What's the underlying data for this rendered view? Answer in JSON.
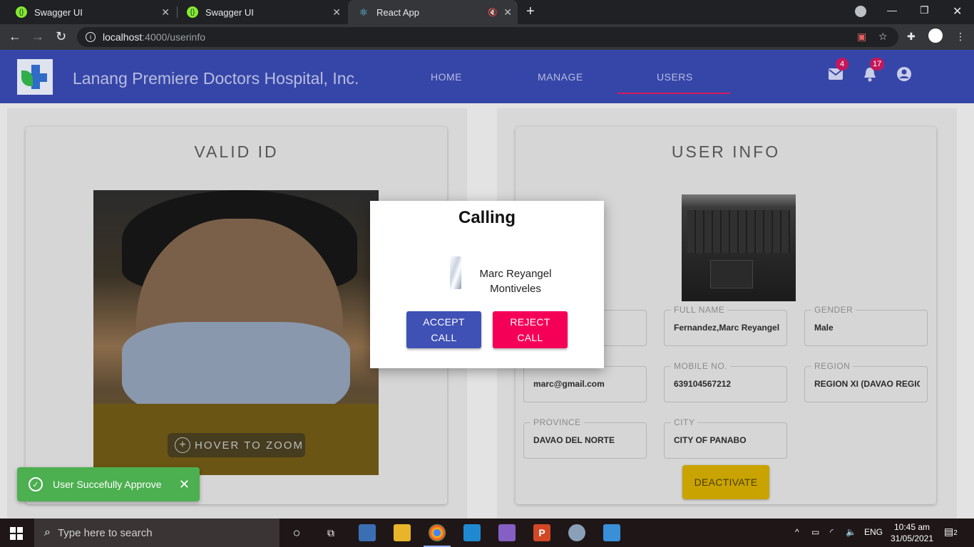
{
  "browser": {
    "tabs": [
      {
        "title": "Swagger UI"
      },
      {
        "title": "Swagger UI"
      },
      {
        "title": "React App"
      }
    ],
    "url_host": "localhost",
    "url_path": ":4000/userinfo"
  },
  "app": {
    "title": "Lanang Premiere Doctors Hospital, Inc.",
    "nav": {
      "home": "HOME",
      "manage": "MANAGE",
      "users": "USERS"
    },
    "mail_badge": "4",
    "notif_badge": "17",
    "accent": "#3646a8"
  },
  "valid_id": {
    "title": "VALID ID",
    "zoom_hint": "HOVER TO ZOOM"
  },
  "user_info": {
    "title": "USER INFO",
    "fields": {
      "full_name": {
        "label": "FULL NAME",
        "value": "Fernandez,Marc Reyangel"
      },
      "gender": {
        "label": "GENDER",
        "value": "Male"
      },
      "email": {
        "value": "marc@gmail.com"
      },
      "mobile": {
        "label": "MOBILE NO.",
        "value": "639104567212"
      },
      "region": {
        "label": "REGION",
        "value": "REGION XI (DAVAO REGION)"
      },
      "province": {
        "label": "PROVINCE",
        "value": "DAVAO DEL NORTE"
      },
      "city": {
        "label": "CITY",
        "value": "CITY OF PANABO"
      }
    },
    "deactivate": "DEACTIVATE"
  },
  "dialog": {
    "title": "Calling",
    "caller_line1": "Marc Reyangel",
    "caller_line2": "Montiveles",
    "accept_line1": "ACCEPT",
    "accept_line2": "CALL",
    "reject_line1": "REJECT",
    "reject_line2": "CALL"
  },
  "toast": {
    "message": "User Succefully Approve",
    "color": "#4caf50"
  },
  "taskbar": {
    "search_placeholder": "Type here to search",
    "lang": "ENG",
    "time": "10:45 am",
    "date": "31/05/2021",
    "notif_count": "2"
  }
}
